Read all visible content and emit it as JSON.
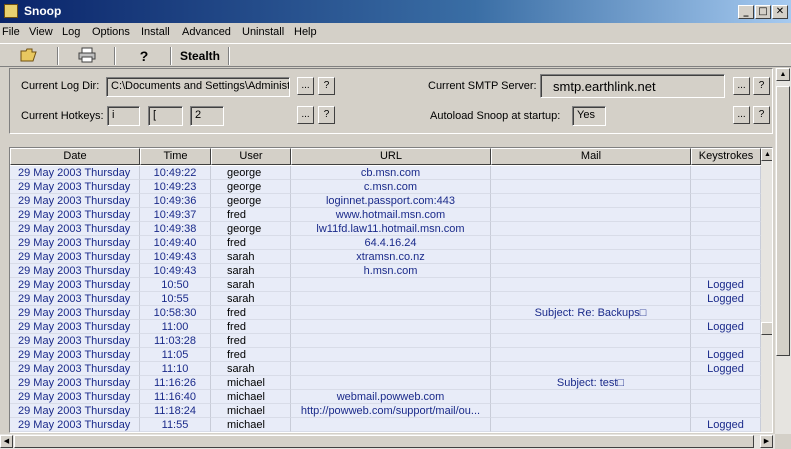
{
  "window": {
    "title": "Snoop"
  },
  "menu": [
    "File",
    "View",
    "Log",
    "Options",
    "Install",
    "Advanced",
    "Uninstall",
    "Help"
  ],
  "toolbar": {
    "stealth_label": "Stealth"
  },
  "settings": {
    "log_dir_label": "Current Log Dir:",
    "log_dir_value": "C:\\Documents and Settings\\Administ",
    "smtp_label": "Current SMTP Server:",
    "smtp_value": "smtp.earthlink.net",
    "hotkeys_label": "Current Hotkeys:",
    "hotkeys": [
      "i",
      "[",
      "2"
    ],
    "autoload_label": "Autoload Snoop at startup:",
    "autoload_value": "Yes",
    "browse_label": "...",
    "help_label": "?"
  },
  "table": {
    "columns": [
      "Date",
      "Time",
      "User",
      "URL",
      "Mail",
      "Keystrokes"
    ],
    "rows": [
      {
        "date": "29 May 2003 Thursday",
        "time": "10:49:22",
        "user": "george",
        "url": "cb.msn.com",
        "mail": "",
        "keys": ""
      },
      {
        "date": "29 May 2003 Thursday",
        "time": "10:49:23",
        "user": "george",
        "url": "c.msn.com",
        "mail": "",
        "keys": ""
      },
      {
        "date": "29 May 2003 Thursday",
        "time": "10:49:36",
        "user": "george",
        "url": "loginnet.passport.com:443",
        "mail": "",
        "keys": ""
      },
      {
        "date": "29 May 2003 Thursday",
        "time": "10:49:37",
        "user": "fred",
        "url": "www.hotmail.msn.com",
        "mail": "",
        "keys": ""
      },
      {
        "date": "29 May 2003 Thursday",
        "time": "10:49:38",
        "user": "george",
        "url": "lw11fd.law11.hotmail.msn.com",
        "mail": "",
        "keys": ""
      },
      {
        "date": "29 May 2003 Thursday",
        "time": "10:49:40",
        "user": "fred",
        "url": "64.4.16.24",
        "mail": "",
        "keys": ""
      },
      {
        "date": "29 May 2003 Thursday",
        "time": "10:49:43",
        "user": "sarah",
        "url": "xtramsn.co.nz",
        "mail": "",
        "keys": ""
      },
      {
        "date": "29 May 2003 Thursday",
        "time": "10:49:43",
        "user": "sarah",
        "url": "h.msn.com",
        "mail": "",
        "keys": ""
      },
      {
        "date": "29 May 2003 Thursday",
        "time": "10:50",
        "user": "sarah",
        "url": "",
        "mail": "",
        "keys": "Logged"
      },
      {
        "date": "29 May 2003 Thursday",
        "time": "10:55",
        "user": "sarah",
        "url": "",
        "mail": "",
        "keys": "Logged"
      },
      {
        "date": "29 May 2003 Thursday",
        "time": "10:58:30",
        "user": "fred",
        "url": "",
        "mail": "Subject: Re: Backups□",
        "keys": ""
      },
      {
        "date": "29 May 2003 Thursday",
        "time": "11:00",
        "user": "fred",
        "url": "",
        "mail": "",
        "keys": "Logged"
      },
      {
        "date": "29 May 2003 Thursday",
        "time": "11:03:28",
        "user": "fred",
        "url": "",
        "mail": "",
        "keys": ""
      },
      {
        "date": "29 May 2003 Thursday",
        "time": "11:05",
        "user": "fred",
        "url": "",
        "mail": "",
        "keys": "Logged"
      },
      {
        "date": "29 May 2003 Thursday",
        "time": "11:10",
        "user": "sarah",
        "url": "",
        "mail": "",
        "keys": "Logged"
      },
      {
        "date": "29 May 2003 Thursday",
        "time": "11:16:26",
        "user": "michael",
        "url": "",
        "mail": "Subject: test□",
        "keys": ""
      },
      {
        "date": "29 May 2003 Thursday",
        "time": "11:16:40",
        "user": "michael",
        "url": "webmail.powweb.com",
        "mail": "",
        "keys": ""
      },
      {
        "date": "29 May 2003 Thursday",
        "time": "11:18:24",
        "user": "michael",
        "url": "http://powweb.com/support/mail/ou...",
        "mail": "",
        "keys": ""
      },
      {
        "date": "29 May 2003 Thursday",
        "time": "11:55",
        "user": "michael",
        "url": "",
        "mail": "",
        "keys": "Logged"
      }
    ]
  },
  "icons": {
    "open": "open-folder-icon",
    "print": "printer-icon",
    "help": "help-icon"
  }
}
